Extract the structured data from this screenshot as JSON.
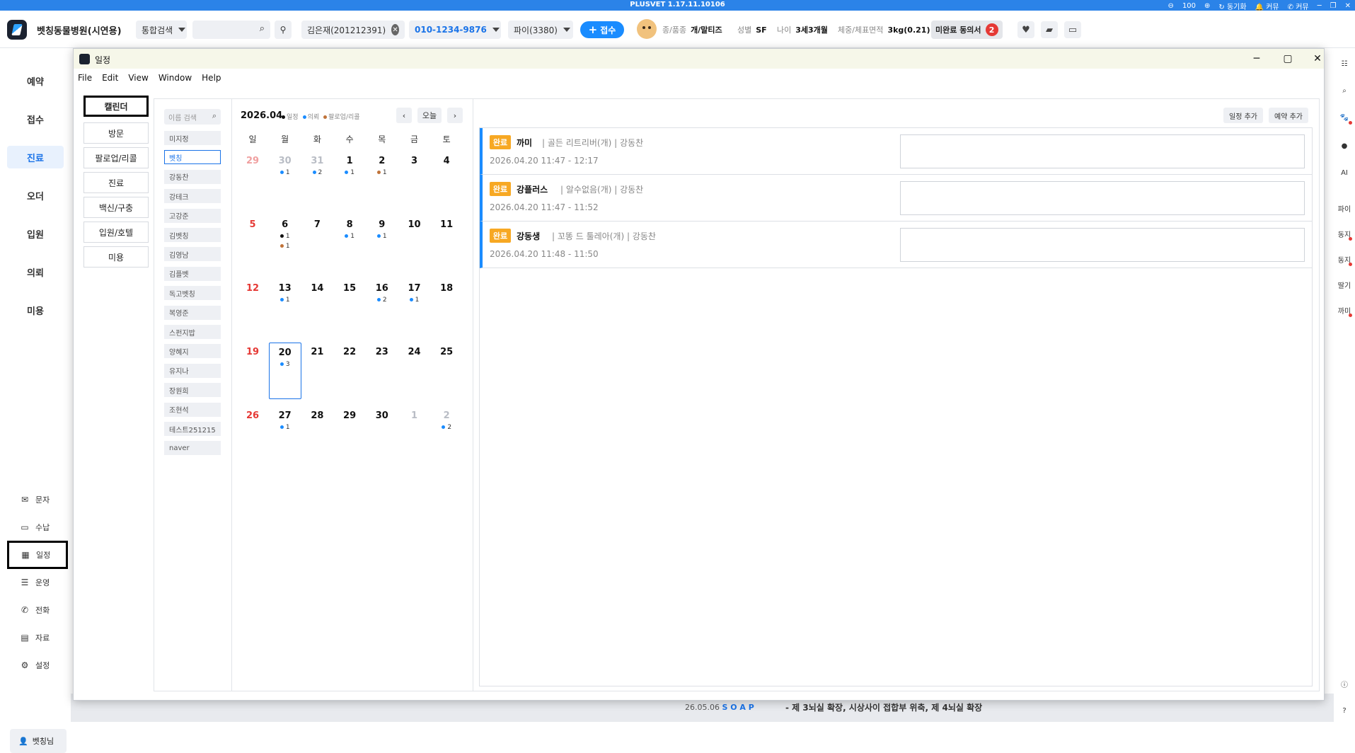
{
  "sysbar": {
    "version": "PLUSVET 1.17.11.10106",
    "zoom": "100",
    "sync": "동기화",
    "alarm": "커뮤",
    "call": "커뮤"
  },
  "header": {
    "hospital": "벳칭동물병원(시연용)",
    "search_scope": "통합검색",
    "client": "김은재(201212391)",
    "phone": "010-1234-9876",
    "pet": "파이(3380)",
    "receipt": "접수",
    "species_k": "종/품종",
    "species_v": "개/말티즈",
    "sex_k": "성별",
    "sex_v": "SF",
    "age_k": "나이",
    "age_v": "3세3개월",
    "weight_k": "체중/체표면적",
    "weight_v": "3kg(0.21)",
    "consent": "미완료 동의서",
    "consent_count": "2"
  },
  "leftnav": {
    "items": [
      "예약",
      "접수",
      "진료",
      "오더",
      "입원",
      "의뢰",
      "미용"
    ],
    "sub": [
      "문자",
      "수납",
      "일정",
      "운영",
      "전화",
      "자료",
      "설정"
    ],
    "user": "벳칭님"
  },
  "rightrail": [
    "파이",
    "동지",
    "동지",
    "딸기",
    "까미"
  ],
  "modal": {
    "title": "일정",
    "menu": [
      "File",
      "Edit",
      "View",
      "Window",
      "Help"
    ],
    "categories": [
      "캘린더",
      "방문",
      "팔로업/리콜",
      "진료",
      "백신/구충",
      "입원/호텔",
      "미용"
    ],
    "name_search_placeholder": "이름 검색",
    "names": [
      "미지정",
      "벳칭",
      "강동찬",
      "강테크",
      "고강준",
      "김벳칭",
      "김영남",
      "김플벳",
      "독고벳칭",
      "복영준",
      "스펀지밥",
      "양혜지",
      "유지나",
      "장원희",
      "조현석",
      "테스트251215",
      "naver"
    ],
    "calendar": {
      "month": "2026.04",
      "legend": [
        "일정",
        "의뢰",
        "팔로업/리콜"
      ],
      "today_btn": "오늘",
      "weekdays": [
        "일",
        "월",
        "화",
        "수",
        "목",
        "금",
        "토"
      ],
      "days": [
        {
          "d": "29",
          "k": "prevsun"
        },
        {
          "d": "30",
          "k": "other",
          "c": [
            [
              "1",
              "#1a8cff"
            ]
          ]
        },
        {
          "d": "31",
          "k": "other",
          "c": [
            [
              "2",
              "#1a8cff"
            ]
          ]
        },
        {
          "d": "1",
          "c": [
            [
              "1",
              "#1a8cff"
            ]
          ]
        },
        {
          "d": "2",
          "c": [
            [
              "1",
              "#c0733a"
            ]
          ]
        },
        {
          "d": "3"
        },
        {
          "d": "4"
        },
        {
          "d": "5",
          "k": "sun"
        },
        {
          "d": "6",
          "c": [
            [
              "1",
              "#111"
            ],
            [
              "1",
              "#c0733a"
            ]
          ]
        },
        {
          "d": "7"
        },
        {
          "d": "8",
          "c": [
            [
              "1",
              "#1a8cff"
            ]
          ]
        },
        {
          "d": "9",
          "c": [
            [
              "1",
              "#1a8cff"
            ]
          ]
        },
        {
          "d": "10"
        },
        {
          "d": "11"
        },
        {
          "d": "12",
          "k": "sun"
        },
        {
          "d": "13",
          "c": [
            [
              "1",
              "#1a8cff"
            ]
          ]
        },
        {
          "d": "14"
        },
        {
          "d": "15"
        },
        {
          "d": "16",
          "c": [
            [
              "2",
              "#1a8cff"
            ]
          ]
        },
        {
          "d": "17",
          "c": [
            [
              "1",
              "#1a8cff"
            ]
          ]
        },
        {
          "d": "18"
        },
        {
          "d": "19",
          "k": "sun"
        },
        {
          "d": "20",
          "today": true,
          "c": [
            [
              "3",
              "#1a8cff"
            ]
          ]
        },
        {
          "d": "21"
        },
        {
          "d": "22"
        },
        {
          "d": "23"
        },
        {
          "d": "24"
        },
        {
          "d": "25"
        },
        {
          "d": "26",
          "k": "sun"
        },
        {
          "d": "27",
          "c": [
            [
              "1",
              "#1a8cff"
            ]
          ]
        },
        {
          "d": "28"
        },
        {
          "d": "29"
        },
        {
          "d": "30"
        },
        {
          "d": "1",
          "k": "other"
        },
        {
          "d": "2",
          "k": "other",
          "c": [
            [
              "2",
              "#1a8cff"
            ]
          ]
        }
      ]
    },
    "list_buttons": {
      "add_schedule": "일정 추가",
      "add_booking": "예약 추가"
    },
    "appointments": [
      {
        "status": "완료",
        "name": "까미",
        "meta": "| 골든 리트리버(개) | 강동찬",
        "time": "2026.04.20 11:47 - 12:17"
      },
      {
        "status": "완료",
        "name": "강플러스",
        "meta": "| 알수없음(개) | 강동찬",
        "time": "2026.04.20 11:47 - 11:52"
      },
      {
        "status": "완료",
        "name": "강동생",
        "meta": "| 꼬똥 드 툴레아(개) | 강동찬",
        "time": "2026.04.20 11:48 - 11:50"
      }
    ]
  },
  "background": {
    "date": "26.05.06",
    "soap": "S O A P",
    "note": "- 제 3뇌실 확장, 시상사이 접합부 위축, 제 4뇌실 확장"
  }
}
